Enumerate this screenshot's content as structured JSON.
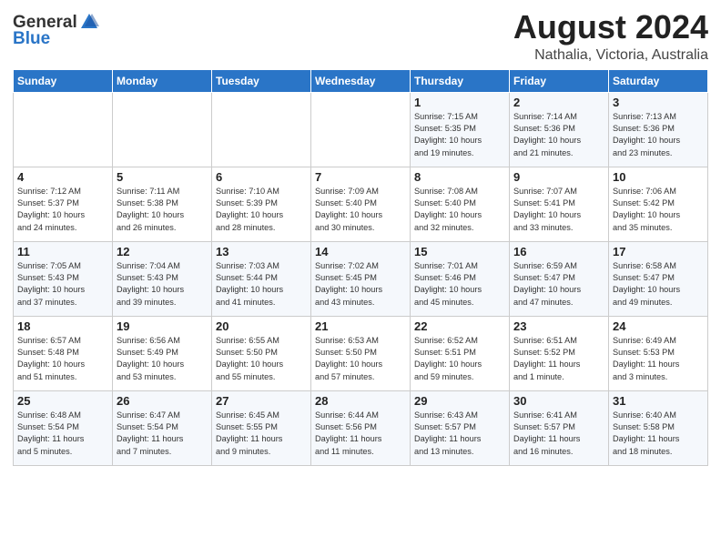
{
  "header": {
    "logo_general": "General",
    "logo_blue": "Blue",
    "month_year": "August 2024",
    "location": "Nathalia, Victoria, Australia"
  },
  "days_of_week": [
    "Sunday",
    "Monday",
    "Tuesday",
    "Wednesday",
    "Thursday",
    "Friday",
    "Saturday"
  ],
  "weeks": [
    [
      {
        "day": "",
        "info": ""
      },
      {
        "day": "",
        "info": ""
      },
      {
        "day": "",
        "info": ""
      },
      {
        "day": "",
        "info": ""
      },
      {
        "day": "1",
        "info": "Sunrise: 7:15 AM\nSunset: 5:35 PM\nDaylight: 10 hours\nand 19 minutes."
      },
      {
        "day": "2",
        "info": "Sunrise: 7:14 AM\nSunset: 5:36 PM\nDaylight: 10 hours\nand 21 minutes."
      },
      {
        "day": "3",
        "info": "Sunrise: 7:13 AM\nSunset: 5:36 PM\nDaylight: 10 hours\nand 23 minutes."
      }
    ],
    [
      {
        "day": "4",
        "info": "Sunrise: 7:12 AM\nSunset: 5:37 PM\nDaylight: 10 hours\nand 24 minutes."
      },
      {
        "day": "5",
        "info": "Sunrise: 7:11 AM\nSunset: 5:38 PM\nDaylight: 10 hours\nand 26 minutes."
      },
      {
        "day": "6",
        "info": "Sunrise: 7:10 AM\nSunset: 5:39 PM\nDaylight: 10 hours\nand 28 minutes."
      },
      {
        "day": "7",
        "info": "Sunrise: 7:09 AM\nSunset: 5:40 PM\nDaylight: 10 hours\nand 30 minutes."
      },
      {
        "day": "8",
        "info": "Sunrise: 7:08 AM\nSunset: 5:40 PM\nDaylight: 10 hours\nand 32 minutes."
      },
      {
        "day": "9",
        "info": "Sunrise: 7:07 AM\nSunset: 5:41 PM\nDaylight: 10 hours\nand 33 minutes."
      },
      {
        "day": "10",
        "info": "Sunrise: 7:06 AM\nSunset: 5:42 PM\nDaylight: 10 hours\nand 35 minutes."
      }
    ],
    [
      {
        "day": "11",
        "info": "Sunrise: 7:05 AM\nSunset: 5:43 PM\nDaylight: 10 hours\nand 37 minutes."
      },
      {
        "day": "12",
        "info": "Sunrise: 7:04 AM\nSunset: 5:43 PM\nDaylight: 10 hours\nand 39 minutes."
      },
      {
        "day": "13",
        "info": "Sunrise: 7:03 AM\nSunset: 5:44 PM\nDaylight: 10 hours\nand 41 minutes."
      },
      {
        "day": "14",
        "info": "Sunrise: 7:02 AM\nSunset: 5:45 PM\nDaylight: 10 hours\nand 43 minutes."
      },
      {
        "day": "15",
        "info": "Sunrise: 7:01 AM\nSunset: 5:46 PM\nDaylight: 10 hours\nand 45 minutes."
      },
      {
        "day": "16",
        "info": "Sunrise: 6:59 AM\nSunset: 5:47 PM\nDaylight: 10 hours\nand 47 minutes."
      },
      {
        "day": "17",
        "info": "Sunrise: 6:58 AM\nSunset: 5:47 PM\nDaylight: 10 hours\nand 49 minutes."
      }
    ],
    [
      {
        "day": "18",
        "info": "Sunrise: 6:57 AM\nSunset: 5:48 PM\nDaylight: 10 hours\nand 51 minutes."
      },
      {
        "day": "19",
        "info": "Sunrise: 6:56 AM\nSunset: 5:49 PM\nDaylight: 10 hours\nand 53 minutes."
      },
      {
        "day": "20",
        "info": "Sunrise: 6:55 AM\nSunset: 5:50 PM\nDaylight: 10 hours\nand 55 minutes."
      },
      {
        "day": "21",
        "info": "Sunrise: 6:53 AM\nSunset: 5:50 PM\nDaylight: 10 hours\nand 57 minutes."
      },
      {
        "day": "22",
        "info": "Sunrise: 6:52 AM\nSunset: 5:51 PM\nDaylight: 10 hours\nand 59 minutes."
      },
      {
        "day": "23",
        "info": "Sunrise: 6:51 AM\nSunset: 5:52 PM\nDaylight: 11 hours\nand 1 minute."
      },
      {
        "day": "24",
        "info": "Sunrise: 6:49 AM\nSunset: 5:53 PM\nDaylight: 11 hours\nand 3 minutes."
      }
    ],
    [
      {
        "day": "25",
        "info": "Sunrise: 6:48 AM\nSunset: 5:54 PM\nDaylight: 11 hours\nand 5 minutes."
      },
      {
        "day": "26",
        "info": "Sunrise: 6:47 AM\nSunset: 5:54 PM\nDaylight: 11 hours\nand 7 minutes."
      },
      {
        "day": "27",
        "info": "Sunrise: 6:45 AM\nSunset: 5:55 PM\nDaylight: 11 hours\nand 9 minutes."
      },
      {
        "day": "28",
        "info": "Sunrise: 6:44 AM\nSunset: 5:56 PM\nDaylight: 11 hours\nand 11 minutes."
      },
      {
        "day": "29",
        "info": "Sunrise: 6:43 AM\nSunset: 5:57 PM\nDaylight: 11 hours\nand 13 minutes."
      },
      {
        "day": "30",
        "info": "Sunrise: 6:41 AM\nSunset: 5:57 PM\nDaylight: 11 hours\nand 16 minutes."
      },
      {
        "day": "31",
        "info": "Sunrise: 6:40 AM\nSunset: 5:58 PM\nDaylight: 11 hours\nand 18 minutes."
      }
    ]
  ]
}
